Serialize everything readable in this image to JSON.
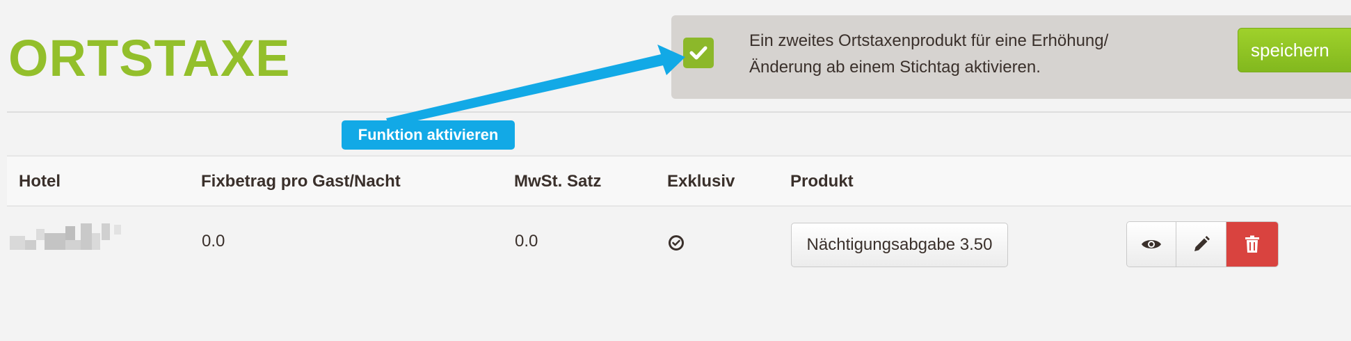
{
  "page": {
    "title": "ORTSTAXE"
  },
  "option": {
    "checked": true,
    "text": "Ein zweites Ortstaxenprodukt für eine Erhöhung/\nÄnderung ab einem Stichtag aktivieren.",
    "save_label": "speichern"
  },
  "annotation": {
    "callout_label": "Funktion aktivieren"
  },
  "table": {
    "headers": {
      "hotel": "Hotel",
      "fixbetrag": "Fixbetrag pro Gast/Nacht",
      "mwst": "MwSt. Satz",
      "exklusiv": "Exklusiv",
      "produkt": "Produkt"
    },
    "rows": [
      {
        "fixbetrag": "0.0",
        "mwst": "0.0",
        "exklusiv": true,
        "produkt": "Nächtigungsabgabe 3.50"
      }
    ]
  },
  "icons": {
    "checkbox": "check-icon",
    "exklusiv": "check-circle-icon",
    "view": "eye-icon",
    "edit": "pencil-icon",
    "delete": "trash-icon"
  },
  "colors": {
    "brand_green": "#93bf2b",
    "callout_blue": "#12a9e6",
    "delete_red": "#d9433f",
    "panel_bg": "#d6d3d0"
  }
}
